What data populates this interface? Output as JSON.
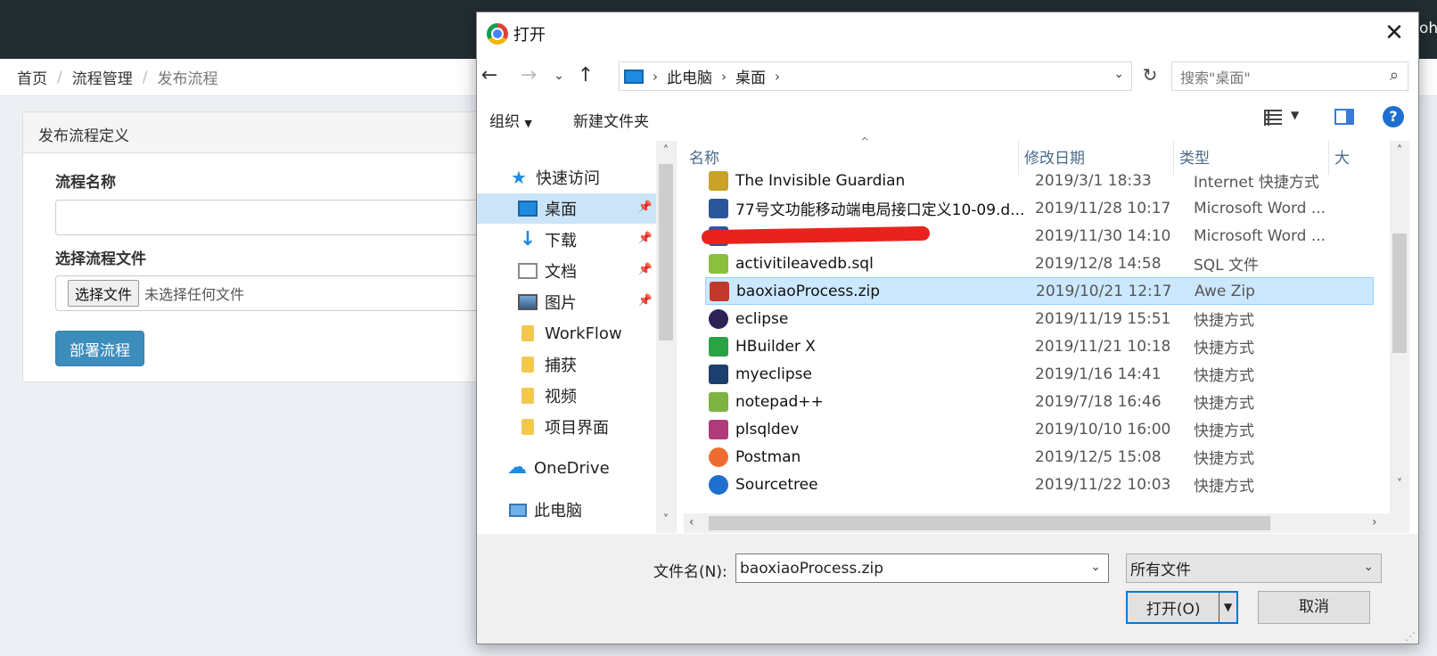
{
  "background": {
    "header_cut_text": "ohp",
    "breadcrumb": [
      "首页",
      "流程管理",
      "发布流程"
    ],
    "panel_title": "发布流程定义",
    "process_name_label": "流程名称",
    "process_file_label": "选择流程文件",
    "choose_file_button": "选择文件",
    "no_file_text": "未选择任何文件",
    "deploy_button": "部署流程",
    "colors": {
      "topbar": "#222d32",
      "primary": "#3c8dbc"
    }
  },
  "dialog": {
    "title": "打开",
    "address": {
      "root": "此电脑",
      "current": "桌面"
    },
    "search_placeholder": "搜索\"桌面\"",
    "toolbar": {
      "organize": "组织",
      "new_folder": "新建文件夹",
      "help": "?"
    },
    "sidebar": [
      {
        "label": "快速访问",
        "icon": "star-icon"
      },
      {
        "label": "桌面",
        "icon": "desktop-icon",
        "pinned": true,
        "selected": true
      },
      {
        "label": "下载",
        "icon": "download-icon",
        "pinned": true
      },
      {
        "label": "文档",
        "icon": "document-icon",
        "pinned": true
      },
      {
        "label": "图片",
        "icon": "picture-icon",
        "pinned": true
      },
      {
        "label": "WorkFlow",
        "icon": "folder-icon"
      },
      {
        "label": "捕获",
        "icon": "folder-icon"
      },
      {
        "label": "视频",
        "icon": "folder-icon"
      },
      {
        "label": "项目界面",
        "icon": "folder-icon"
      },
      {
        "label": "OneDrive",
        "icon": "cloud-icon"
      },
      {
        "label": "此电脑",
        "icon": "computer-icon"
      }
    ],
    "columns": [
      "名称",
      "修改日期",
      "类型",
      "大"
    ],
    "files": [
      {
        "name": "The Invisible Guardian",
        "date": "2019/3/1 18:33",
        "type": "Internet 快捷方式",
        "icon_color": "#c9a227"
      },
      {
        "name": "77号文功能移动端电局接口定义10-09.d...",
        "date": "2019/11/28 10:17",
        "type": "Microsoft Word ...",
        "icon_color": "#2b579a"
      },
      {
        "name": "",
        "date": "2019/11/30 14:10",
        "type": "Microsoft Word ...",
        "icon_color": "#2b579a"
      },
      {
        "name": "activitileavedb.sql",
        "date": "2019/12/8 14:58",
        "type": "SQL 文件",
        "icon_color": "#8cbf3f"
      },
      {
        "name": "baoxiaoProcess.zip",
        "date": "2019/10/21 12:17",
        "type": "Awe Zip",
        "icon_color": "#c0392b",
        "selected": true
      },
      {
        "name": "eclipse",
        "date": "2019/11/19 15:51",
        "type": "快捷方式",
        "icon_color": "#2c2255"
      },
      {
        "name": "HBuilder X",
        "date": "2019/11/21 10:18",
        "type": "快捷方式",
        "icon_color": "#2aa345"
      },
      {
        "name": "myeclipse",
        "date": "2019/1/16 14:41",
        "type": "快捷方式",
        "icon_color": "#1c3f6e"
      },
      {
        "name": "notepad++",
        "date": "2019/7/18 16:46",
        "type": "快捷方式",
        "icon_color": "#7cb342"
      },
      {
        "name": "plsqldev",
        "date": "2019/10/10 16:00",
        "type": "快捷方式",
        "icon_color": "#b03a7a"
      },
      {
        "name": "Postman",
        "date": "2019/12/5 15:08",
        "type": "快捷方式",
        "icon_color": "#ef6c30"
      },
      {
        "name": "Sourcetree",
        "date": "2019/11/22 10:03",
        "type": "快捷方式",
        "icon_color": "#1f6fd0"
      }
    ],
    "filename_label": "文件名(N):",
    "filename_value": "baoxiaoProcess.zip",
    "filter_value": "所有文件",
    "open_button": "打开(O)",
    "cancel_button": "取消"
  }
}
